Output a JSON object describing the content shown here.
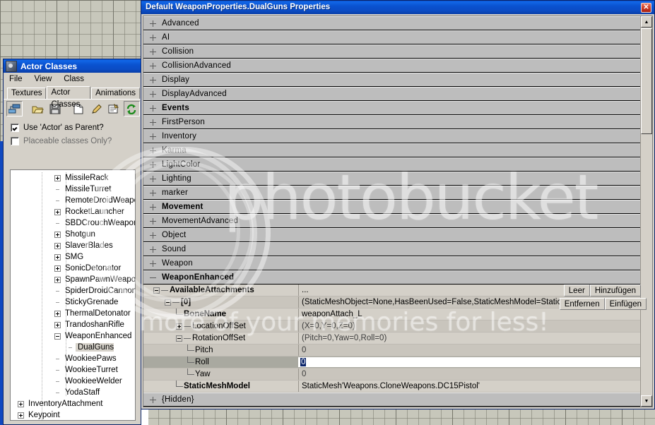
{
  "properties_window": {
    "title": "Default WeaponProperties.DualGuns Properties",
    "close_label": "✕",
    "categories": [
      {
        "label": "Advanced",
        "bold": false,
        "expanded": false
      },
      {
        "label": "AI",
        "bold": false,
        "expanded": false
      },
      {
        "label": "Collision",
        "bold": false,
        "expanded": false
      },
      {
        "label": "CollisionAdvanced",
        "bold": false,
        "expanded": false
      },
      {
        "label": "Display",
        "bold": false,
        "expanded": false
      },
      {
        "label": "DisplayAdvanced",
        "bold": false,
        "expanded": false
      },
      {
        "label": "Events",
        "bold": true,
        "expanded": false
      },
      {
        "label": "FirstPerson",
        "bold": false,
        "expanded": false
      },
      {
        "label": "Inventory",
        "bold": false,
        "expanded": false
      },
      {
        "label": "Karma",
        "bold": false,
        "expanded": false
      },
      {
        "label": "LightColor",
        "bold": false,
        "expanded": false
      },
      {
        "label": "Lighting",
        "bold": false,
        "expanded": false
      },
      {
        "label": "marker",
        "bold": false,
        "expanded": false
      },
      {
        "label": "Movement",
        "bold": true,
        "expanded": false
      },
      {
        "label": "MovementAdvanced",
        "bold": false,
        "expanded": false
      },
      {
        "label": "Object",
        "bold": false,
        "expanded": false
      },
      {
        "label": "Sound",
        "bold": false,
        "expanded": false
      },
      {
        "label": "Weapon",
        "bold": false,
        "expanded": false
      },
      {
        "label": "WeaponEnhanced",
        "bold": true,
        "expanded": true
      }
    ],
    "sub_properties": [
      {
        "name": "AvailableAttachments",
        "value": "...",
        "bold": true,
        "node": "minus",
        "depth": 1
      },
      {
        "name": "[0]",
        "value": "(StaticMeshObject=None,HasBeenUsed=False,StaticMeshModel=StaticMes...",
        "bold": true,
        "node": "minus",
        "depth": 2
      },
      {
        "name": "BoneName",
        "value": "weaponAttach_L",
        "bold": true,
        "node": "leaf",
        "depth": 3
      },
      {
        "name": "LocationOffSet",
        "value": "(X=0,Y=0,Z=0)",
        "bold": false,
        "node": "plus",
        "depth": 3
      },
      {
        "name": "RotationOffSet",
        "value": "(Pitch=0,Yaw=0,Roll=0)",
        "bold": false,
        "node": "minus",
        "depth": 3
      },
      {
        "name": "Pitch",
        "value": "0",
        "bold": false,
        "node": "leaf",
        "depth": 4
      },
      {
        "name": "Roll",
        "value": "0",
        "bold": false,
        "node": "leaf",
        "depth": 4,
        "selected": true,
        "editing": true
      },
      {
        "name": "Yaw",
        "value": "0",
        "bold": false,
        "node": "leaf",
        "depth": 4
      },
      {
        "name": "StaticMeshModel",
        "value": "StaticMesh'Weapons.CloneWeapons.DC15Pistol'",
        "bold": true,
        "node": "leaf",
        "depth": 3
      }
    ],
    "array_buttons_row1": [
      "Leer",
      "Hinzufügen"
    ],
    "array_buttons_row2": [
      "Entfernen",
      "Einfügen"
    ],
    "hidden_row": {
      "label": "{Hidden}"
    },
    "scrollbar": {
      "up": "▲",
      "down": "▼"
    }
  },
  "actor_classes_window": {
    "title": "Actor Classes",
    "menu": [
      "File",
      "View",
      "Class"
    ],
    "tabs": [
      {
        "label": "Textures",
        "active": false
      },
      {
        "label": "Actor Classes",
        "active": true
      },
      {
        "label": "Animations",
        "active": false
      }
    ],
    "toolbar_icons": [
      "hierarchy-icon",
      "open-folder-icon",
      "save-disk-icon",
      "new-document-icon",
      "edit-pencil-icon",
      "properties-icon",
      "refresh-icon"
    ],
    "checkboxes": [
      {
        "label": "Use 'Actor' as Parent?",
        "checked": true
      },
      {
        "label": "Placeable classes Only?",
        "checked": false
      }
    ],
    "tree": [
      {
        "label": "MissileRack",
        "node": "plus",
        "depth": 3
      },
      {
        "label": "MissileTurret",
        "node": "none",
        "depth": 3
      },
      {
        "label": "RemoteDroidWeapon",
        "node": "none",
        "depth": 3
      },
      {
        "label": "RocketLauncher",
        "node": "plus",
        "depth": 3
      },
      {
        "label": "SBDCrouchWeapon",
        "node": "none",
        "depth": 3
      },
      {
        "label": "Shotgun",
        "node": "plus",
        "depth": 3
      },
      {
        "label": "SlaverBlades",
        "node": "plus",
        "depth": 3
      },
      {
        "label": "SMG",
        "node": "plus",
        "depth": 3
      },
      {
        "label": "SonicDetonator",
        "node": "plus",
        "depth": 3
      },
      {
        "label": "SpawnPawnWeapon",
        "node": "plus",
        "depth": 3
      },
      {
        "label": "SpiderDroidCannon",
        "node": "none",
        "depth": 3
      },
      {
        "label": "StickyGrenade",
        "node": "none",
        "depth": 3
      },
      {
        "label": "ThermalDetonator",
        "node": "plus",
        "depth": 3
      },
      {
        "label": "TrandoshanRifle",
        "node": "plus",
        "depth": 3
      },
      {
        "label": "WeaponEnhanced",
        "node": "minus",
        "depth": 3
      },
      {
        "label": "DualGuns",
        "node": "none",
        "depth": 4,
        "selected": true
      },
      {
        "label": "WookieePaws",
        "node": "none",
        "depth": 3
      },
      {
        "label": "WookieeTurret",
        "node": "none",
        "depth": 3
      },
      {
        "label": "WookieeWelder",
        "node": "none",
        "depth": 3
      },
      {
        "label": "YodaStaff",
        "node": "none",
        "depth": 3
      },
      {
        "label": "InventoryAttachment",
        "node": "plus",
        "depth": 1
      },
      {
        "label": "Keypoint",
        "node": "plus",
        "depth": 1
      }
    ]
  },
  "watermark": {
    "brand": "photobucket",
    "tagline": "more of your memories for less!"
  },
  "colors": {
    "title_blue": "#0a50c8",
    "window_face": "#d4d0c8",
    "category_row": "#bdbdbd",
    "selection": "#0a246a",
    "close_red": "#d0422a"
  }
}
